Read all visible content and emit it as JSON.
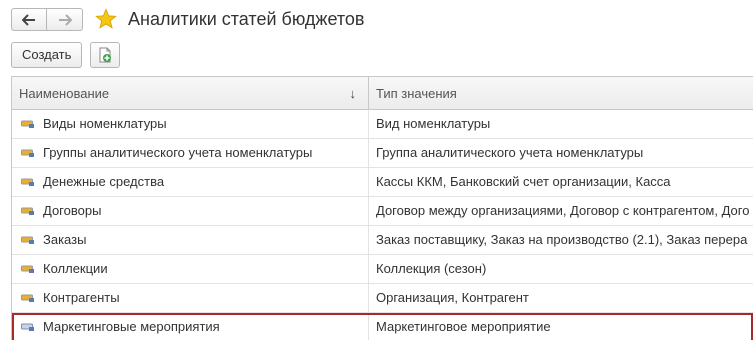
{
  "window": {
    "title": "Аналитики статей бюджетов"
  },
  "nav": {
    "back_icon": "arrow-left-icon",
    "forward_icon": "arrow-right-icon",
    "favorite_icon": "star-icon"
  },
  "toolbar": {
    "create_label": "Создать",
    "copy_icon": "copy-add-icon"
  },
  "table": {
    "columns": [
      {
        "label": "Наименование",
        "sort": "↓"
      },
      {
        "label": "Тип значения"
      }
    ],
    "rows": [
      {
        "name": "Виды номенклатуры",
        "type": "Вид номенклатуры"
      },
      {
        "name": "Группы аналитического учета номенклатуры",
        "type": "Группа аналитического учета номенклатуры"
      },
      {
        "name": "Денежные средства",
        "type": "Кассы ККМ, Банковский счет организации, Касса"
      },
      {
        "name": "Договоры",
        "type": "Договор между организациями, Договор с контрагентом, Дого"
      },
      {
        "name": "Заказы",
        "type": "Заказ поставщику, Заказ на производство (2.1), Заказ перера"
      },
      {
        "name": "Коллекции",
        "type": "Коллекция (сезон)"
      },
      {
        "name": "Контрагенты",
        "type": "Организация, Контрагент"
      },
      {
        "name": "Маркетинговые мероприятия",
        "type": "Маркетинговое мероприятие"
      }
    ],
    "selected_row": 7
  },
  "colors": {
    "selection_outline": "#a52a2a",
    "star": "#f5c518",
    "row_icon": "#e8b030"
  }
}
